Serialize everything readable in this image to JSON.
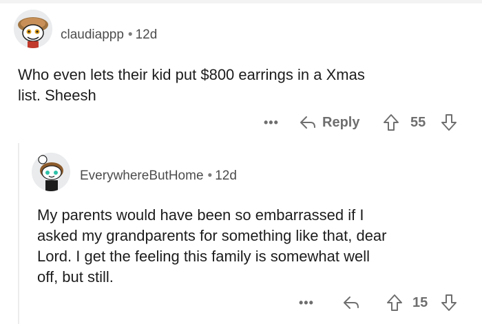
{
  "comment": {
    "username": "claudiappp",
    "separator": "•",
    "age": "12d",
    "text_line1": "Who even lets their kid put $800 earrings in a Xmas",
    "text_line2": "list. Sheesh",
    "more_label": "•••",
    "reply_label": "Reply",
    "votes": "55"
  },
  "reply": {
    "username": "EverywhereButHome",
    "separator": "•",
    "age": "12d",
    "text_line1": "My parents would have been so embarrassed if I",
    "text_line2": "asked my grandparents for something like that, dear",
    "text_line3": "Lord.  I get the feeling this family is somewhat well",
    "text_line4": "off, but still.",
    "more_label": "•••",
    "votes": "15"
  },
  "icons": {
    "reply": "reply-arrow-icon",
    "upvote": "upvote-arrow-icon",
    "downvote": "downvote-arrow-icon"
  },
  "colors": {
    "text": "#1c1c1c",
    "meta": "#4c4c4c",
    "action": "#6e6e6e",
    "thread_line": "#ececec"
  }
}
